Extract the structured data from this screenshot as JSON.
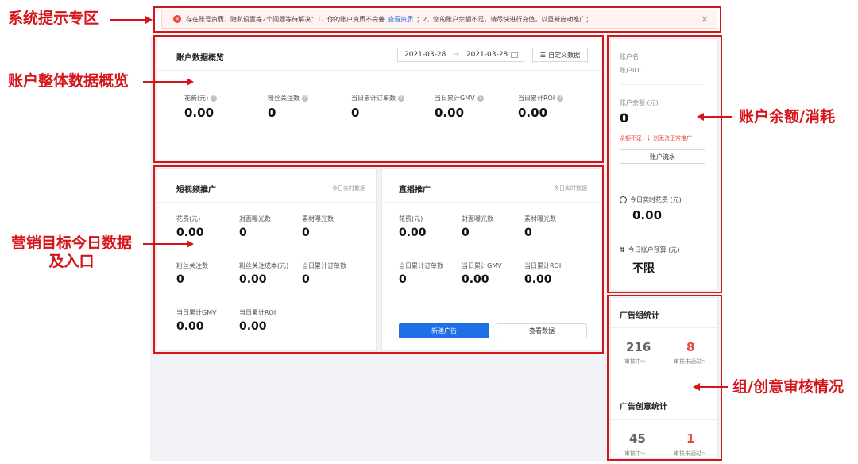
{
  "callouts": {
    "notice": "系统提示专区",
    "overview": "账户整体数据概览",
    "marketing_line1": "营销目标今日数据",
    "marketing_line2": "及入口",
    "balance": "账户余额/消耗",
    "review": "组/创意审核情况"
  },
  "notice": {
    "icon": "error-icon",
    "text_before": "存在账号资质、隐私设置等2个问题等待解决：1、你的账户资质不完善",
    "link": "查看资质",
    "text_after": "；2、您的账户余额不足，请尽快进行充值，以重新启动推广；",
    "close": "×"
  },
  "overview": {
    "title": "账户数据概览",
    "date_start": "2021-03-28",
    "date_sep": "→",
    "date_end": "2021-03-28",
    "custom_button": "自定义数据",
    "metrics": [
      {
        "label": "花费(元)",
        "value": "0.00"
      },
      {
        "label": "粉丝关注数",
        "value": "0"
      },
      {
        "label": "当日累计订单数",
        "value": "0"
      },
      {
        "label": "当日累计GMV",
        "value": "0.00"
      },
      {
        "label": "当日累计ROI",
        "value": "0.00"
      }
    ]
  },
  "short_video": {
    "title": "短视频推广",
    "link": "今日实时数据",
    "metrics": [
      {
        "label": "花费(元)",
        "value": "0.00"
      },
      {
        "label": "封面曝光数",
        "value": "0"
      },
      {
        "label": "素材曝光数",
        "value": "0"
      },
      {
        "label": "粉丝关注数",
        "value": "0"
      },
      {
        "label": "粉丝关注成本(元)",
        "value": "0.00"
      },
      {
        "label": "当日累计订单数",
        "value": "0"
      },
      {
        "label": "当日累计GMV",
        "value": "0.00"
      },
      {
        "label": "当日累计ROI",
        "value": "0.00"
      }
    ]
  },
  "live": {
    "title": "直播推广",
    "link": "今日实时数据",
    "metrics": [
      {
        "label": "花费(元)",
        "value": "0.00"
      },
      {
        "label": "封面曝光数",
        "value": "0"
      },
      {
        "label": "素材曝光数",
        "value": "0"
      },
      {
        "label": "当日累计订单数",
        "value": "0"
      },
      {
        "label": "当日累计GMV",
        "value": "0.00"
      },
      {
        "label": "当日累计ROI",
        "value": "0.00"
      }
    ],
    "new_ad_button": "新建广告",
    "view_data_button": "查看数据"
  },
  "account": {
    "name_label": "账户名:",
    "id_label": "账户ID:",
    "balance_label": "账户余额 (元)",
    "balance_value": "0",
    "warning": "余额不足，计划无法正常推广",
    "flow_button": "账户流水",
    "today_spend_label": "今日实时花费 (元)",
    "today_spend_value": "0.00",
    "budget_label": "今日账户预算 (元)",
    "budget_value": "不限"
  },
  "ad_group_stats": {
    "title": "广告组统计",
    "reviewing_value": "216",
    "reviewing_label": "审核中>",
    "rejected_value": "8",
    "rejected_label": "审核未通过>"
  },
  "creative_stats": {
    "title": "广告创意统计",
    "reviewing_value": "45",
    "reviewing_label": "审核中>",
    "rejected_value": "1",
    "rejected_label": "审核未通过>"
  },
  "colors": {
    "annotation_red": "#d6151b",
    "primary_blue": "#1f6fe5",
    "warning_red": "#e5483f"
  }
}
